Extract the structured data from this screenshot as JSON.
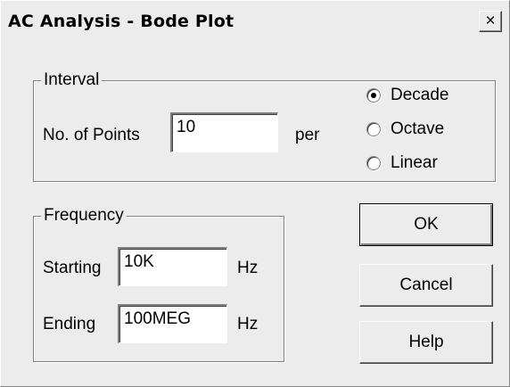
{
  "window": {
    "title": "AC Analysis - Bode Plot",
    "close_label": "×"
  },
  "interval": {
    "legend": "Interval",
    "points_label": "No. of Points",
    "points_value": "10",
    "per_label": "per",
    "options": [
      {
        "label": "Decade",
        "selected": true
      },
      {
        "label": "Octave",
        "selected": false
      },
      {
        "label": "Linear",
        "selected": false
      }
    ]
  },
  "frequency": {
    "legend": "Frequency",
    "starting_label": "Starting",
    "starting_value": "10K",
    "starting_unit": "Hz",
    "ending_label": "Ending",
    "ending_value": "100MEG",
    "ending_unit": "Hz"
  },
  "buttons": {
    "ok": "OK",
    "cancel": "Cancel",
    "help": "Help"
  }
}
